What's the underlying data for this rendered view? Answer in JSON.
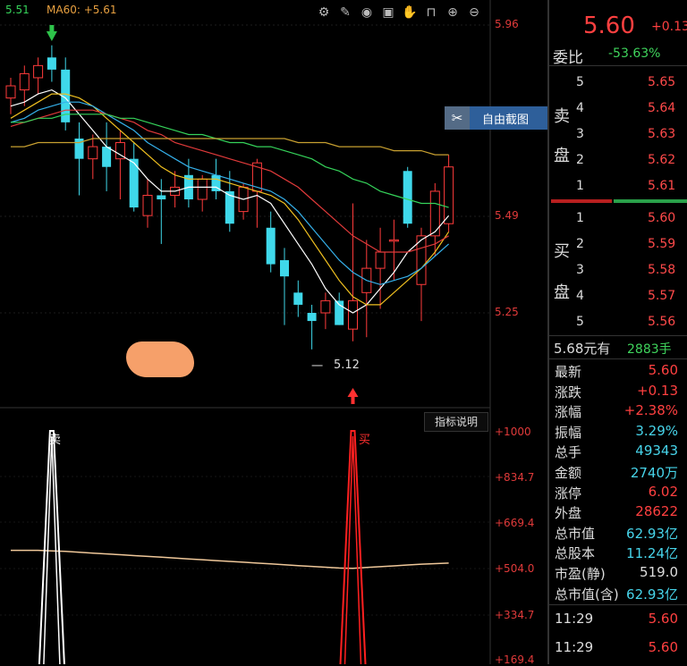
{
  "ma_labels": {
    "ma_a": "5.51",
    "ma60": "MA60: +5.61"
  },
  "toolbar_icons": [
    "gear-icon",
    "pen-icon",
    "eye-icon",
    "bag-icon",
    "hand-icon",
    "lock-icon",
    "zoom-in-icon",
    "zoom-out-icon"
  ],
  "price_scale": [
    "5.96",
    "5.49",
    "5.25"
  ],
  "low_marker": "5.12",
  "indicator_button": "指标说明",
  "indicator_scale": [
    "+1000",
    "+834.7",
    "+669.4",
    "+504.0",
    "+334.7",
    "+169.4"
  ],
  "signals": {
    "sell": "卖",
    "buy": "买"
  },
  "popup": {
    "close": "✂",
    "label": "自由截图"
  },
  "header": {
    "price": "5.60",
    "change": "+0.13"
  },
  "webi": {
    "label": "委比",
    "value": "-53.63%"
  },
  "sell_side_label": "卖\n盘",
  "buy_side_label": "买\n盘",
  "sell_orders": [
    {
      "level": "5",
      "price": "5.65"
    },
    {
      "level": "4",
      "price": "5.64"
    },
    {
      "level": "3",
      "price": "5.63"
    },
    {
      "level": "2",
      "price": "5.62"
    },
    {
      "level": "1",
      "price": "5.61"
    }
  ],
  "buy_orders": [
    {
      "level": "1",
      "price": "5.60"
    },
    {
      "level": "2",
      "price": "5.59"
    },
    {
      "level": "3",
      "price": "5.58"
    },
    {
      "level": "4",
      "price": "5.57"
    },
    {
      "level": "5",
      "price": "5.56"
    }
  ],
  "bid_summary": {
    "text": "5.68元有",
    "volume": "2883手"
  },
  "stats": [
    {
      "key": "最新",
      "value": "5.60",
      "color": "red"
    },
    {
      "key": "涨跌",
      "value": "+0.13",
      "color": "red"
    },
    {
      "key": "涨幅",
      "value": "+2.38%",
      "color": "red"
    },
    {
      "key": "振幅",
      "value": "3.29%",
      "color": "cyan"
    },
    {
      "key": "总手",
      "value": "49343",
      "color": "cyan"
    },
    {
      "key": "金额",
      "value": "2740万",
      "color": "cyan"
    },
    {
      "key": "涨停",
      "value": "6.02",
      "color": "red"
    },
    {
      "key": "外盘",
      "value": "28622",
      "color": "red"
    },
    {
      "key": "总市值",
      "value": "62.93亿",
      "color": "cyan"
    },
    {
      "key": "总股本",
      "value": "11.24亿",
      "color": "cyan"
    },
    {
      "key": "市盈(静)",
      "value": "519.0",
      "color": "white"
    },
    {
      "key": "总市值(含)",
      "value": "62.93亿",
      "color": "cyan"
    }
  ],
  "ticks": [
    {
      "time": "11:29",
      "price": "5.60"
    },
    {
      "time": "11:29",
      "price": "5.60"
    }
  ],
  "chart_data": {
    "type": "candlestick",
    "price_range": [
      5.05,
      6.0
    ],
    "candles": [
      {
        "o": 5.78,
        "h": 5.83,
        "l": 5.74,
        "c": 5.81,
        "up": true
      },
      {
        "o": 5.8,
        "h": 5.86,
        "l": 5.76,
        "c": 5.84,
        "up": true
      },
      {
        "o": 5.83,
        "h": 5.88,
        "l": 5.79,
        "c": 5.86,
        "up": true
      },
      {
        "o": 5.88,
        "h": 5.91,
        "l": 5.82,
        "c": 5.85,
        "up": false
      },
      {
        "o": 5.85,
        "h": 5.88,
        "l": 5.7,
        "c": 5.72,
        "up": false
      },
      {
        "o": 5.68,
        "h": 5.72,
        "l": 5.54,
        "c": 5.63,
        "up": false
      },
      {
        "o": 5.63,
        "h": 5.69,
        "l": 5.58,
        "c": 5.66,
        "up": true
      },
      {
        "o": 5.66,
        "h": 5.72,
        "l": 5.55,
        "c": 5.61,
        "up": false
      },
      {
        "o": 5.63,
        "h": 5.7,
        "l": 5.53,
        "c": 5.67,
        "up": true
      },
      {
        "o": 5.63,
        "h": 5.67,
        "l": 5.5,
        "c": 5.51,
        "up": false
      },
      {
        "o": 5.49,
        "h": 5.58,
        "l": 5.46,
        "c": 5.54,
        "up": true
      },
      {
        "o": 5.54,
        "h": 5.58,
        "l": 5.42,
        "c": 5.53,
        "up": false
      },
      {
        "o": 5.54,
        "h": 5.6,
        "l": 5.51,
        "c": 5.56,
        "up": true
      },
      {
        "o": 5.59,
        "h": 5.63,
        "l": 5.51,
        "c": 5.53,
        "up": false
      },
      {
        "o": 5.53,
        "h": 5.59,
        "l": 5.5,
        "c": 5.58,
        "up": true
      },
      {
        "o": 5.59,
        "h": 5.63,
        "l": 5.53,
        "c": 5.55,
        "up": false
      },
      {
        "o": 5.55,
        "h": 5.6,
        "l": 5.45,
        "c": 5.47,
        "up": false
      },
      {
        "o": 5.5,
        "h": 5.57,
        "l": 5.48,
        "c": 5.56,
        "up": true
      },
      {
        "o": 5.55,
        "h": 5.63,
        "l": 5.46,
        "c": 5.62,
        "up": true
      },
      {
        "o": 5.46,
        "h": 5.5,
        "l": 5.35,
        "c": 5.37,
        "up": false
      },
      {
        "o": 5.38,
        "h": 5.41,
        "l": 5.22,
        "c": 5.34,
        "up": false
      },
      {
        "o": 5.3,
        "h": 5.33,
        "l": 5.24,
        "c": 5.27,
        "up": false
      },
      {
        "o": 5.25,
        "h": 5.27,
        "l": 5.16,
        "c": 5.23,
        "up": false
      },
      {
        "o": 5.25,
        "h": 5.3,
        "l": 5.21,
        "c": 5.28,
        "up": true
      },
      {
        "o": 5.28,
        "h": 5.3,
        "l": 5.22,
        "c": 5.22,
        "up": false
      },
      {
        "o": 5.21,
        "h": 5.52,
        "l": 5.18,
        "c": 5.28,
        "up": true
      },
      {
        "o": 5.3,
        "h": 5.43,
        "l": 5.19,
        "c": 5.36,
        "up": true
      },
      {
        "o": 5.36,
        "h": 5.46,
        "l": 5.26,
        "c": 5.4,
        "up": true
      },
      {
        "o": 5.43,
        "h": 5.48,
        "l": 5.33,
        "c": 5.43,
        "up": true
      },
      {
        "o": 5.6,
        "h": 5.61,
        "l": 5.46,
        "c": 5.47,
        "up": false
      },
      {
        "o": 5.32,
        "h": 5.46,
        "l": 5.23,
        "c": 5.44,
        "up": true
      },
      {
        "o": 5.44,
        "h": 5.57,
        "l": 5.39,
        "c": 5.55,
        "up": true
      },
      {
        "o": 5.47,
        "h": 5.64,
        "l": 5.45,
        "c": 5.61,
        "up": true
      }
    ],
    "ma_lines": [
      {
        "color": "#ffffff",
        "values": [
          5.76,
          5.77,
          5.79,
          5.8,
          5.78,
          5.74,
          5.7,
          5.66,
          5.64,
          5.62,
          5.58,
          5.55,
          5.55,
          5.56,
          5.56,
          5.56,
          5.54,
          5.53,
          5.54,
          5.52,
          5.47,
          5.42,
          5.37,
          5.31,
          5.27,
          5.25,
          5.27,
          5.31,
          5.35,
          5.4,
          5.43,
          5.45,
          5.49
        ]
      },
      {
        "color": "#f0c020",
        "values": [
          5.73,
          5.75,
          5.77,
          5.79,
          5.79,
          5.78,
          5.76,
          5.73,
          5.7,
          5.67,
          5.64,
          5.61,
          5.59,
          5.58,
          5.58,
          5.58,
          5.57,
          5.56,
          5.55,
          5.54,
          5.52,
          5.48,
          5.43,
          5.38,
          5.33,
          5.29,
          5.27,
          5.27,
          5.3,
          5.33,
          5.36,
          5.4,
          5.45
        ]
      },
      {
        "color": "#35b0ea",
        "values": [
          5.72,
          5.73,
          5.75,
          5.76,
          5.77,
          5.77,
          5.76,
          5.74,
          5.72,
          5.7,
          5.67,
          5.65,
          5.63,
          5.61,
          5.6,
          5.59,
          5.58,
          5.57,
          5.56,
          5.55,
          5.53,
          5.5,
          5.46,
          5.42,
          5.38,
          5.35,
          5.33,
          5.32,
          5.33,
          5.34,
          5.36,
          5.39,
          5.42
        ]
      },
      {
        "color": "#e03a3a",
        "values": [
          5.71,
          5.72,
          5.73,
          5.74,
          5.75,
          5.75,
          5.75,
          5.74,
          5.73,
          5.72,
          5.7,
          5.69,
          5.67,
          5.66,
          5.65,
          5.64,
          5.63,
          5.62,
          5.61,
          5.6,
          5.58,
          5.56,
          5.53,
          5.5,
          5.47,
          5.44,
          5.42,
          5.4,
          5.4,
          5.4,
          5.41,
          5.42,
          5.44
        ]
      },
      {
        "color": "#35d35a",
        "values": [
          5.72,
          5.72,
          5.73,
          5.73,
          5.74,
          5.74,
          5.74,
          5.74,
          5.73,
          5.73,
          5.72,
          5.71,
          5.7,
          5.69,
          5.69,
          5.68,
          5.67,
          5.67,
          5.66,
          5.66,
          5.65,
          5.64,
          5.63,
          5.61,
          5.6,
          5.58,
          5.57,
          5.55,
          5.54,
          5.53,
          5.52,
          5.52,
          5.51
        ]
      },
      {
        "color": "#c8a030",
        "values": [
          5.66,
          5.66,
          5.67,
          5.67,
          5.67,
          5.67,
          5.68,
          5.68,
          5.68,
          5.68,
          5.68,
          5.68,
          5.68,
          5.68,
          5.68,
          5.68,
          5.68,
          5.68,
          5.68,
          5.68,
          5.68,
          5.67,
          5.67,
          5.67,
          5.66,
          5.66,
          5.66,
          5.66,
          5.65,
          5.65,
          5.65,
          5.64,
          5.64
        ]
      }
    ],
    "indicator": {
      "range": [
        169.4,
        1000
      ],
      "line": [
        570,
        570,
        570,
        568,
        566,
        563,
        560,
        557,
        554,
        551,
        548,
        545,
        542,
        539,
        536,
        533,
        530,
        527,
        524,
        521,
        518,
        515,
        512,
        509,
        506,
        505,
        508,
        511,
        514,
        517,
        520,
        522,
        524
      ],
      "sell_spike_index": 3,
      "buy_spike_index": 25,
      "spike_value": 1000
    }
  }
}
